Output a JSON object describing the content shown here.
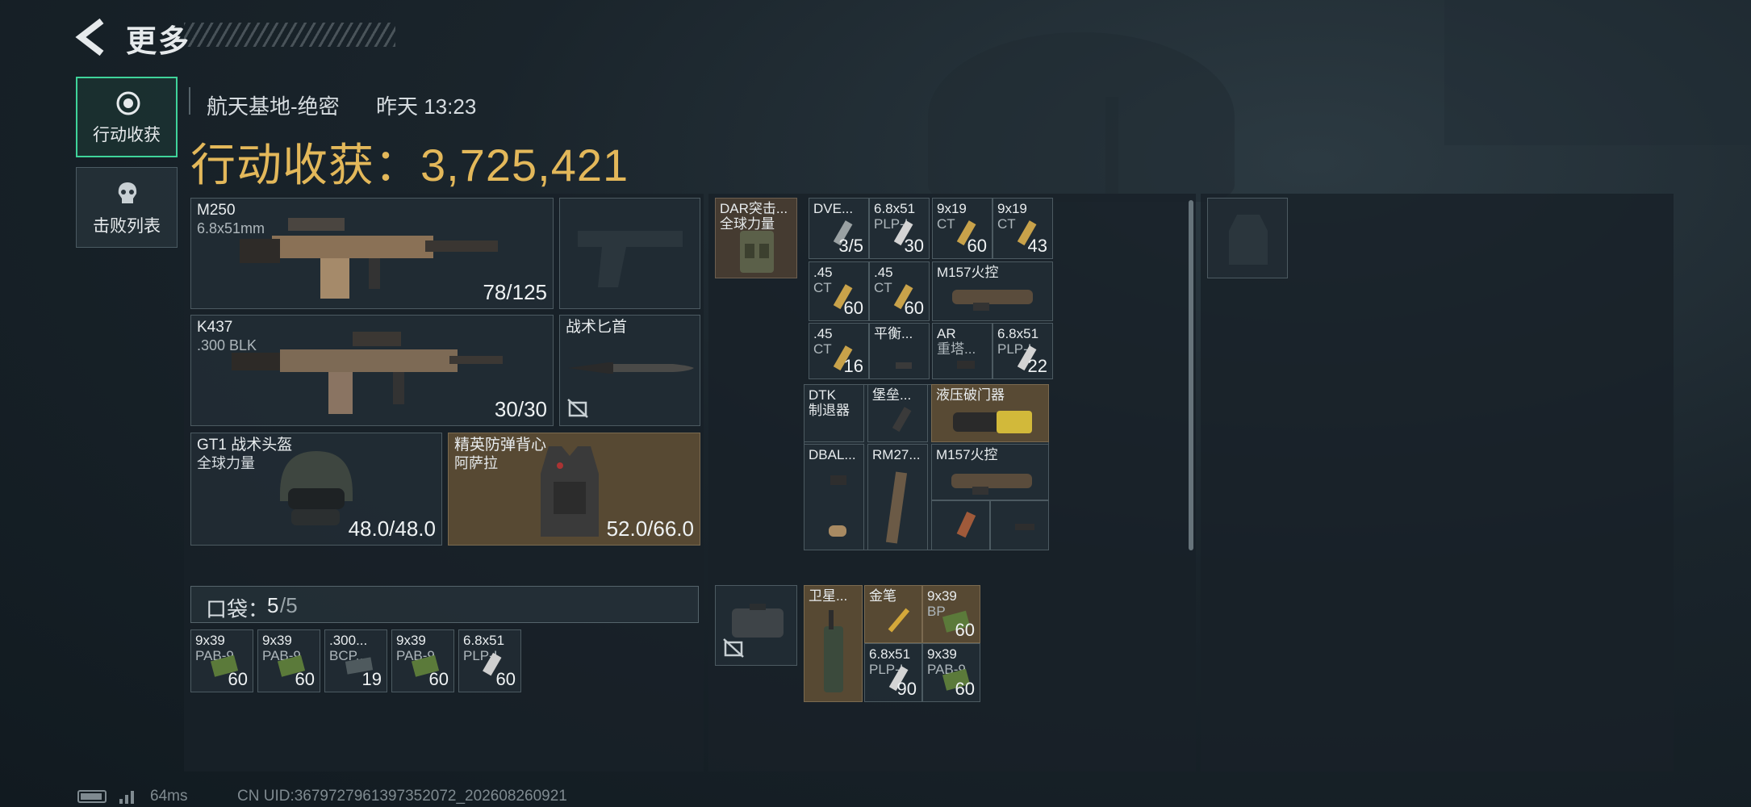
{
  "header": {
    "title": "更多",
    "back_icon": "back-arrow-icon"
  },
  "tabs": [
    {
      "label": "行动收获",
      "icon": "loot-icon",
      "active": true
    },
    {
      "label": "击败列表",
      "icon": "skull-icon",
      "active": false
    }
  ],
  "raid": {
    "map": "航天基地-绝密",
    "time": "昨天 13:23",
    "earnings_label": "行动收获：",
    "earnings_value": "3,725,421"
  },
  "equipment": {
    "primary": {
      "name": "M250",
      "caliber": "6.8x51mm",
      "ammo": "78/125"
    },
    "sidearm": {
      "name": ""
    },
    "secondary": {
      "name": "K437",
      "caliber": ".300 BLK",
      "ammo": "30/30"
    },
    "melee": {
      "name": "战术匕首"
    },
    "helmet": {
      "name": "GT1 战术头盔",
      "brand": "全球力量",
      "durability": "48.0/48.0"
    },
    "armor": {
      "name": "精英防弹背心",
      "brand": "阿萨拉",
      "durability": "52.0/66.0"
    }
  },
  "pocket": {
    "label": "口袋：",
    "used": "5",
    "total": "/5",
    "items": [
      {
        "name": "9x39",
        "sub": "PAB-9",
        "count": "60"
      },
      {
        "name": "9x39",
        "sub": "PAB-9",
        "count": "60"
      },
      {
        "name": ".300...",
        "sub": "BCP...",
        "count": "19"
      },
      {
        "name": "9x39",
        "sub": "PAB-9",
        "count": "60"
      },
      {
        "name": "6.8x51",
        "sub": "PLP-I",
        "count": "60"
      }
    ]
  },
  "chest_rig": {
    "name": "DAR突击...",
    "brand": "全球力量"
  },
  "rig_items": [
    {
      "name": "DVE...",
      "count": "3/5"
    },
    {
      "name": "6.8x51",
      "sub": "PLP-I",
      "count": "30"
    },
    {
      "name": "9x19",
      "sub": "CT",
      "count": "60"
    },
    {
      "name": "9x19",
      "sub": "CT",
      "count": "43"
    },
    {
      "name": ".45",
      "sub": "CT",
      "count": "60"
    },
    {
      "name": ".45",
      "sub": "CT",
      "count": "60"
    },
    {
      "name": "M157火控"
    },
    {
      "name": ".45",
      "sub": "CT",
      "count": "16"
    },
    {
      "name": "平衡..."
    },
    {
      "name": "AR",
      "sub": "重塔..."
    },
    {
      "name": "6.8x51",
      "sub": "PLP-I",
      "count": "22"
    }
  ],
  "bag_items": [
    {
      "name": "DTK",
      "sub": "制退器"
    },
    {
      "name": "堡垒..."
    },
    {
      "name": "液压破门器"
    },
    {
      "name": "DBAL..."
    },
    {
      "name": "RM27..."
    },
    {
      "name": "M157火控"
    }
  ],
  "case_items": [
    {
      "name": "卫星..."
    },
    {
      "name": "金笔"
    },
    {
      "name": "9x39",
      "sub": "BP",
      "count": "60"
    },
    {
      "name": "6.8x51",
      "sub": "PLP-I",
      "count": "90"
    },
    {
      "name": "9x39",
      "sub": "PAB-9",
      "count": "60"
    }
  ],
  "footer": {
    "ping": "64ms",
    "uid": "CN UID:3679727961397352072_202608260921"
  },
  "colors": {
    "accent_green": "#3fd39a",
    "earnings_gold": "#e3b85a"
  }
}
